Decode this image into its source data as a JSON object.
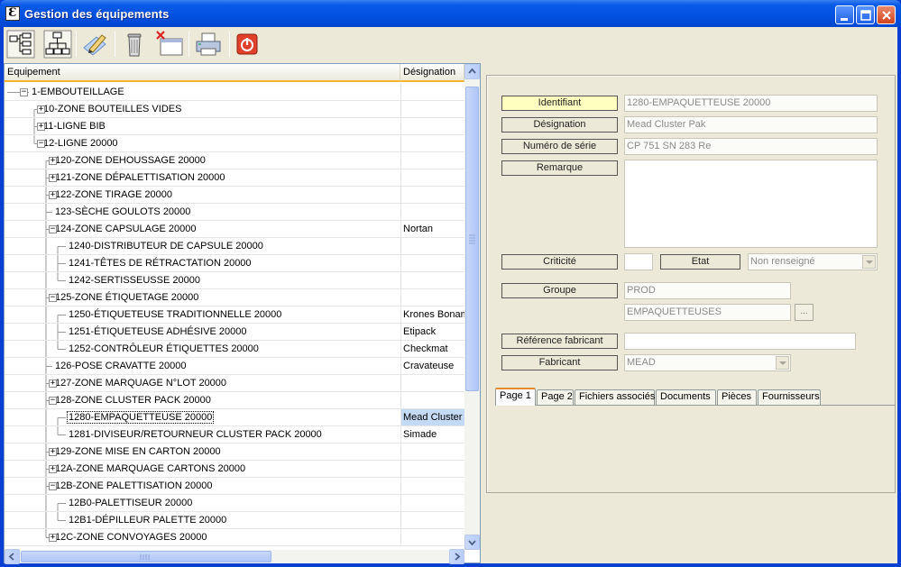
{
  "window": {
    "title": "Gestion des équipements",
    "icon_letter": "Ɛ"
  },
  "toolbar": {
    "buttons": [
      {
        "name": "tree-expand-icon"
      },
      {
        "name": "hierarchy-icon"
      },
      {
        "name": "edit-pencil-icon"
      },
      {
        "name": "trash-icon"
      },
      {
        "name": "delete-window-icon"
      },
      {
        "name": "printer-icon"
      },
      {
        "name": "power-icon"
      }
    ]
  },
  "tree": {
    "headers": {
      "equipement": "Equipement",
      "designation": "Désignation"
    },
    "rows": [
      {
        "label": "1-EMBOUTEILLAGE",
        "level": 0,
        "expander": "-",
        "designation": ""
      },
      {
        "label": "10-ZONE BOUTEILLES VIDES",
        "level": 1,
        "expander": "+",
        "designation": ""
      },
      {
        "label": "11-LIGNE BIB",
        "level": 1,
        "expander": "+",
        "designation": ""
      },
      {
        "label": "12-LIGNE 20000",
        "level": 1,
        "expander": "-",
        "designation": ""
      },
      {
        "label": "120-ZONE DEHOUSSAGE 20000",
        "level": 2,
        "expander": "+",
        "designation": ""
      },
      {
        "label": "121-ZONE DÉPALETTISATION 20000",
        "level": 2,
        "expander": "+",
        "designation": ""
      },
      {
        "label": "122-ZONE TIRAGE 20000",
        "level": 2,
        "expander": "+",
        "designation": ""
      },
      {
        "label": "123-SÈCHE GOULOTS 20000",
        "level": 2,
        "expander": "",
        "designation": ""
      },
      {
        "label": "124-ZONE CAPSULAGE 20000",
        "level": 2,
        "expander": "-",
        "designation": "Nortan"
      },
      {
        "label": "1240-DISTRIBUTEUR DE CAPSULE 20000",
        "level": 3,
        "expander": "",
        "designation": ""
      },
      {
        "label": "1241-TÊTES DE RÉTRACTATION 20000",
        "level": 3,
        "expander": "",
        "designation": ""
      },
      {
        "label": "1242-SERTISSEUSSE 20000",
        "level": 3,
        "expander": "",
        "designation": ""
      },
      {
        "label": "125-ZONE ÉTIQUETAGE 20000",
        "level": 2,
        "expander": "-",
        "designation": ""
      },
      {
        "label": "1250-ÉTIQUETEUSE TRADITIONNELLE 20000",
        "level": 3,
        "expander": "",
        "designation": "Krones Bonam"
      },
      {
        "label": "1251-ÉTIQUETEUSE ADHÉSIVE 20000",
        "level": 3,
        "expander": "",
        "designation": "Etipack"
      },
      {
        "label": "1252-CONTRÔLEUR ÉTIQUETTES 20000",
        "level": 3,
        "expander": "",
        "designation": "Checkmat"
      },
      {
        "label": "126-POSE CRAVATTE 20000",
        "level": 2,
        "expander": "",
        "designation": "Cravateuse"
      },
      {
        "label": "127-ZONE MARQUAGE N°LOT 20000",
        "level": 2,
        "expander": "+",
        "designation": ""
      },
      {
        "label": "128-ZONE CLUSTER PACK 20000",
        "level": 2,
        "expander": "-",
        "designation": ""
      },
      {
        "label": "1280-EMPAQUETTEUSE 20000",
        "level": 3,
        "expander": "",
        "designation": "Mead Cluster P",
        "selected": true
      },
      {
        "label": "1281-DIVISEUR/RETOURNEUR CLUSTER PACK 20000",
        "level": 3,
        "expander": "",
        "designation": "Simade"
      },
      {
        "label": "129-ZONE MISE EN CARTON 20000",
        "level": 2,
        "expander": "+",
        "designation": ""
      },
      {
        "label": "12A-ZONE MARQUAGE CARTONS 20000",
        "level": 2,
        "expander": "+",
        "designation": ""
      },
      {
        "label": "12B-ZONE PALETTISATION 20000",
        "level": 2,
        "expander": "-",
        "designation": ""
      },
      {
        "label": "12B0-PALETTISEUR 20000",
        "level": 3,
        "expander": "",
        "designation": ""
      },
      {
        "label": "12B1-DÉPILLEUR PALETTE 20000",
        "level": 3,
        "expander": "",
        "designation": ""
      },
      {
        "label": "12C-ZONE CONVOYAGES 20000",
        "level": 2,
        "expander": "+",
        "designation": ""
      }
    ]
  },
  "detail": {
    "identifiant_label": "Identifiant",
    "identifiant_value": "1280-EMPAQUETTEUSE 20000",
    "designation_label": "Désignation",
    "designation_value": "Mead Cluster Pak",
    "serie_label": "Numéro de série",
    "serie_value": "CP 751 SN 283 Re",
    "remarque_label": "Remarque",
    "remarque_value": "",
    "criticite_label": "Criticité",
    "criticite_value": "",
    "etat_label": "Etat",
    "etat_value": "Non renseigné",
    "groupe_label": "Groupe",
    "groupe_value": "PROD",
    "groupe_sub_value": "EMPAQUETTEUSES",
    "dots_label": "...",
    "ref_fab_label": "Référence fabricant",
    "ref_fab_value": "",
    "fabricant_label": "Fabricant",
    "fabricant_value": "MEAD"
  },
  "tabs": [
    "Page 1",
    "Page 2",
    "Fichiers associés",
    "Documents",
    "Pièces",
    "Fournisseurs"
  ],
  "colors": {
    "titlebar": "#0250df",
    "header_underline": "#f9b130",
    "selection": "#c4daf4",
    "identifiant_label_bg": "#ffffc0"
  }
}
